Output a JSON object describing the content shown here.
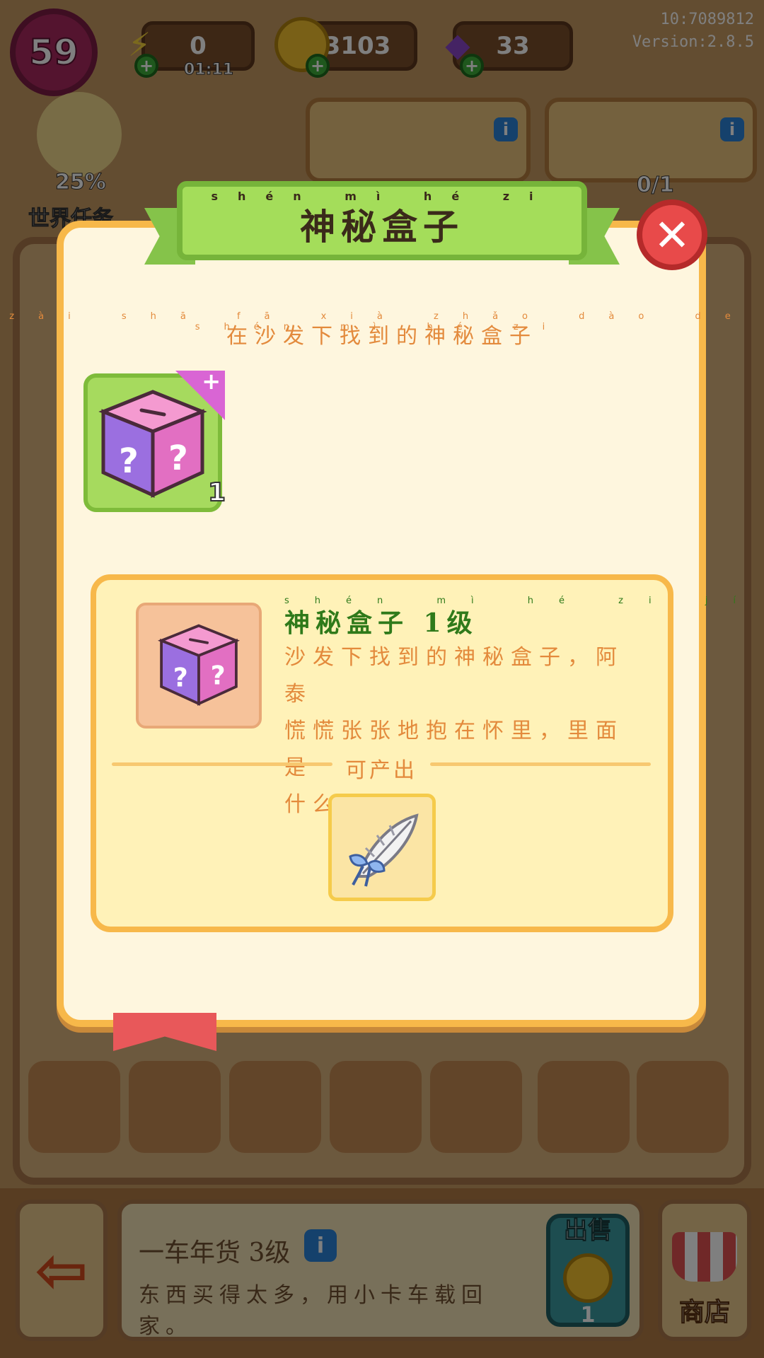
{
  "hud": {
    "level": "59",
    "energy_value": "0",
    "energy_timer": "01:11",
    "coins": "3103",
    "gems": "33",
    "user_id": "10:7089812",
    "version": "Version:2.8.5",
    "world_task_percent": "25%",
    "world_task_label": "世界任务",
    "order_progress": "0/1"
  },
  "modal": {
    "title": "神秘盒子",
    "title_pinyin": "shén mì hé zi",
    "subtitle": "在沙发下找到的神秘盒子",
    "subtitle_pinyin": "zài shā fā xià zhǎo dào de shén mì hé zi",
    "item_count": "1",
    "corner_badge": "+",
    "detail": {
      "name": "神秘盒子 1级",
      "name_pinyin": "shén mì hé zi   jí",
      "description_line1": "沙发下找到的神秘盒子，阿泰",
      "description_line2": "慌慌张张地抱在怀里，里面是",
      "description_line3": "什么呢？"
    },
    "produces_label": "可产出",
    "produces_item": "white-feather-with-blue-bow",
    "close_icon": "close-icon"
  },
  "bottom": {
    "item_title": "一车年货 3级",
    "item_desc_line1": "东西买得太多，用小卡车载回",
    "item_desc_line2": "家。",
    "sell_label": "出售",
    "sell_price": "1",
    "shop_label": "商店"
  },
  "colors": {
    "modal_border": "#f7b84a",
    "ribbon_green": "#a4dd5a",
    "close_red": "#e84a4a",
    "accent_orange": "#e38a3c",
    "name_green": "#2f7a1a"
  }
}
